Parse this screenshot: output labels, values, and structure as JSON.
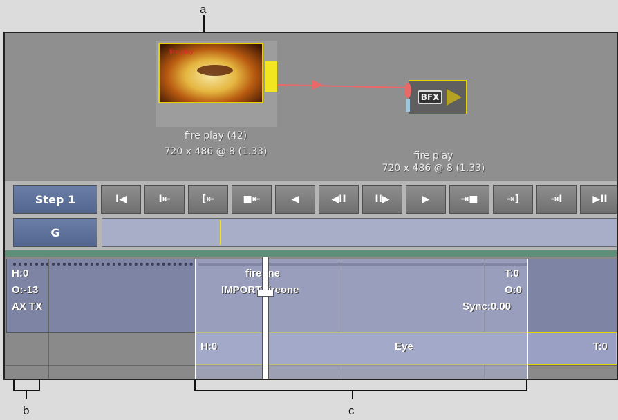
{
  "callouts": {
    "a": "a",
    "b": "b",
    "c": "c"
  },
  "schematic": {
    "source_node": {
      "image_text": "fire play",
      "name": "fire play (42)",
      "format": "720 x 486 @ 8 (1.33)"
    },
    "bfx_node": {
      "tag": "BFX",
      "name": "fire play",
      "format": "720 x 486 @ 8 (1.33)"
    }
  },
  "toolbar": {
    "step_label": "Step 1",
    "g_label": "G",
    "transport": [
      "I◀",
      "I⇤",
      "[⇤",
      "■⇤",
      "◀",
      "◀II",
      "II▶",
      "▶",
      "⇥■",
      "⇥]",
      "⇥I",
      "▶II"
    ]
  },
  "tracks": {
    "header": {
      "h": "H:0",
      "o": "O:-13",
      "ax_tx": "AX TX"
    },
    "clip": {
      "name": "fireone",
      "source": "IMPORT fireone",
      "t": "T:0",
      "o": "O:0",
      "sync": "Sync:0.00"
    },
    "eye": {
      "h": "H:0",
      "name": "Eye",
      "t": "T:0"
    }
  }
}
